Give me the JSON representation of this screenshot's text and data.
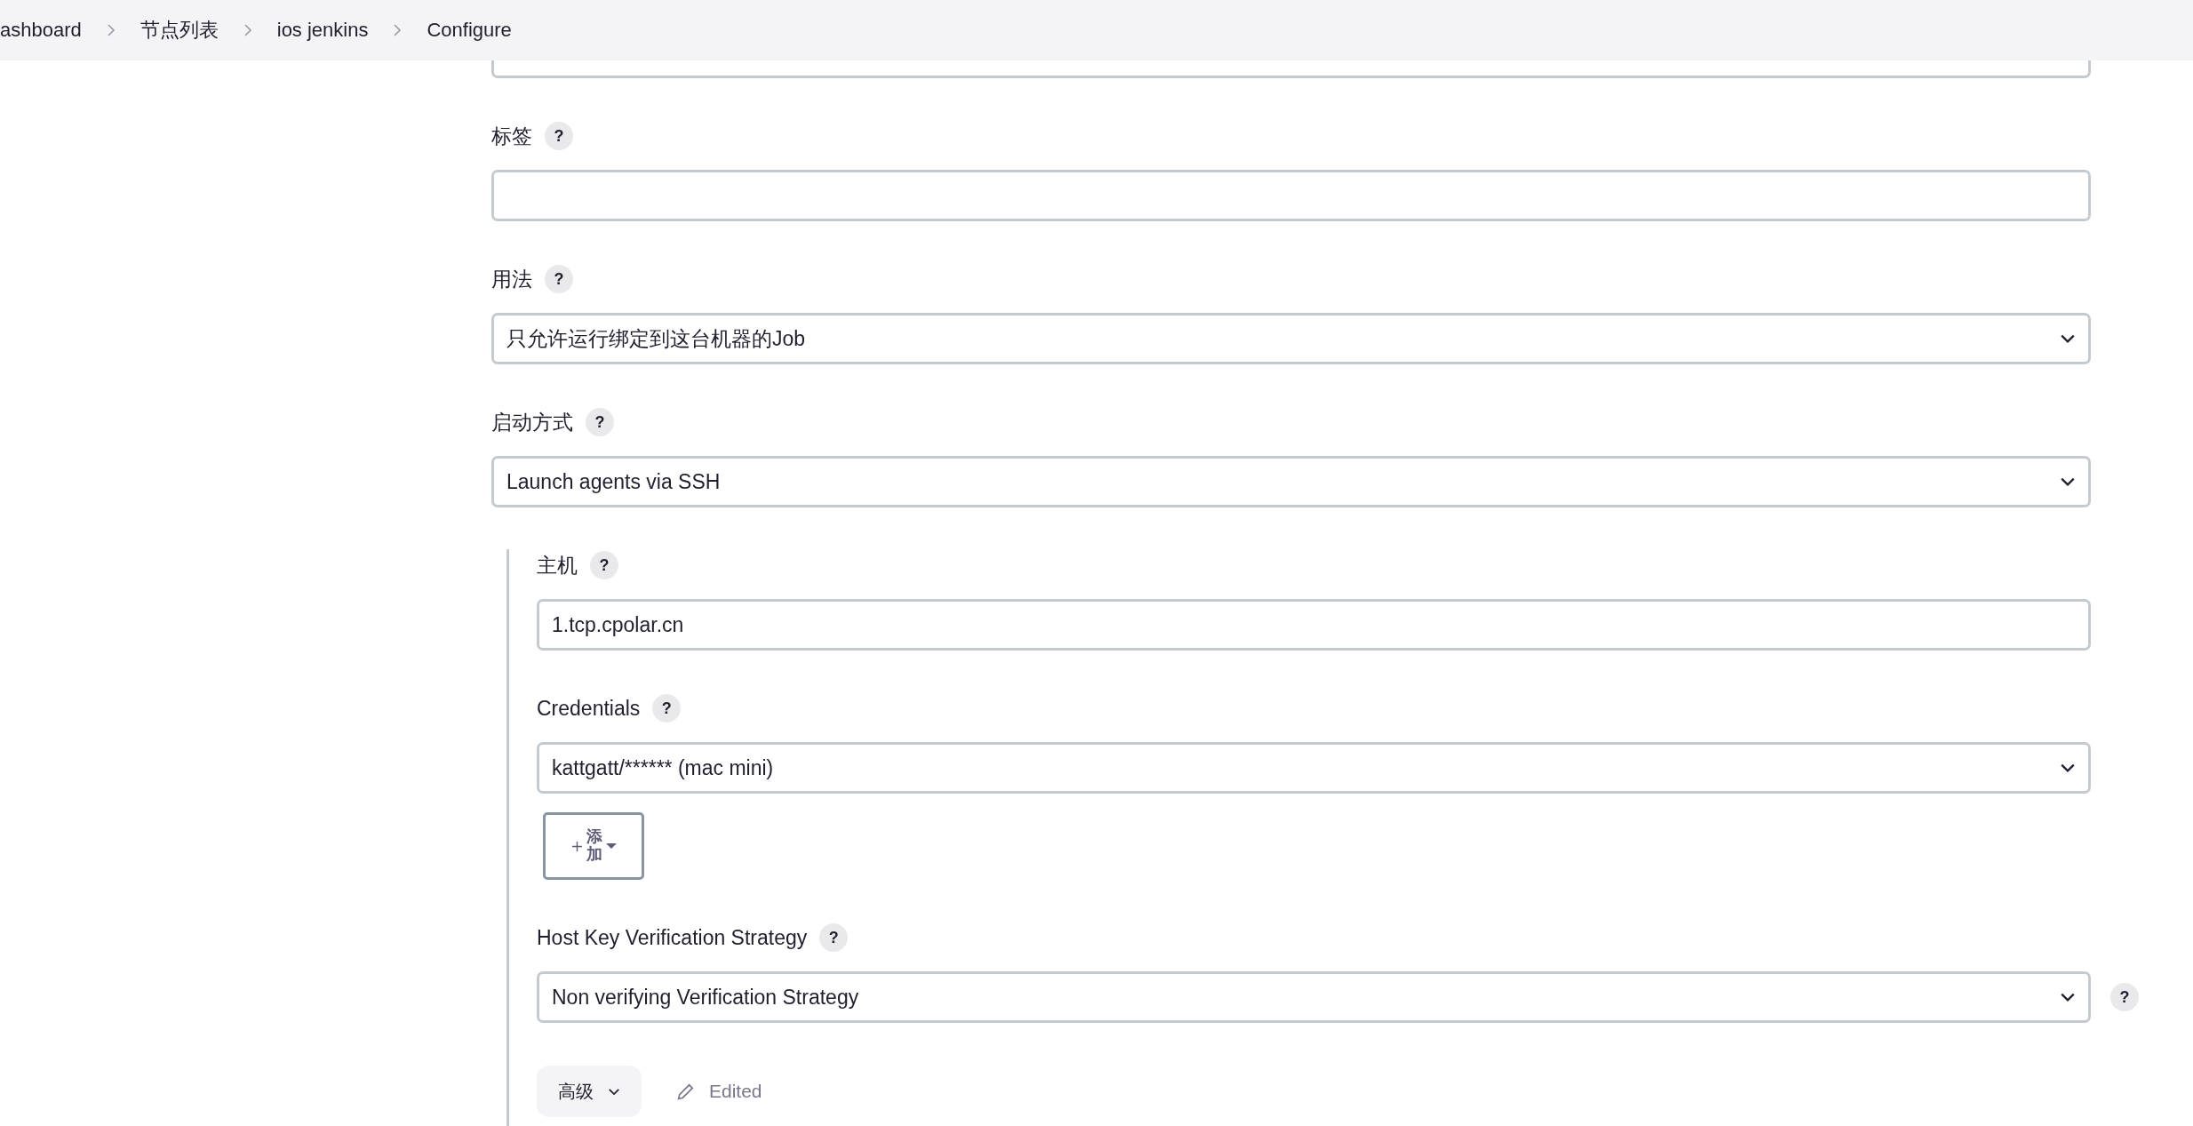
{
  "breadcrumb": [
    {
      "label": "ashboard"
    },
    {
      "label": "节点列表"
    },
    {
      "label": "ios jenkins"
    },
    {
      "label": "Configure"
    }
  ],
  "fields": [
    {
      "label": "标签",
      "kind": "text",
      "help": "?"
    },
    {
      "label": "用法",
      "kind": "select",
      "help": "?",
      "value": "只允许运行绑定到这台机器的Job"
    },
    {
      "label": "启动方式",
      "kind": "select",
      "help": "?",
      "value": "Launch agents via SSH"
    }
  ],
  "launch_section": {
    "fields": [
      {
        "label": "主机",
        "kind": "text",
        "help": "?",
        "value": "1.tcp.cpolar.cn"
      },
      {
        "label": "Credentials",
        "kind": "select",
        "help": "?",
        "value": "kattgatt/****** (mac mini)",
        "add_button": "添加"
      },
      {
        "label": "Host Key Verification Strategy",
        "kind": "select",
        "help": "?",
        "side_help": "?",
        "value": "Non verifying Verification Strategy"
      }
    ],
    "advanced_button": "高级",
    "status": "Edited"
  }
}
